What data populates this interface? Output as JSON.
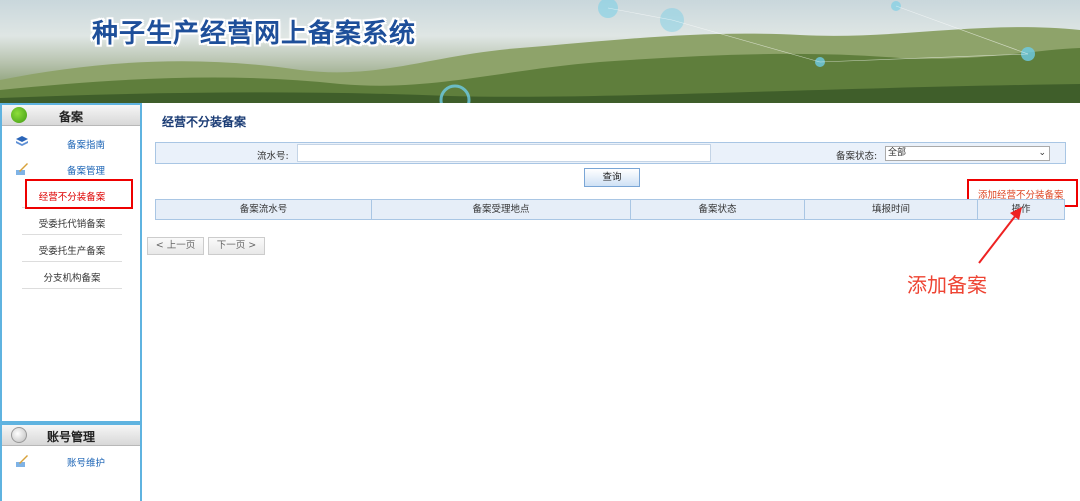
{
  "app": {
    "title": "种子生产经营网上备案系统"
  },
  "sidebar": {
    "section1_title": "备案",
    "guide": "备案指南",
    "manage": "备案管理",
    "items": [
      {
        "label": "经营不分装备案",
        "active": true
      },
      {
        "label": "受委托代销备案",
        "active": false
      },
      {
        "label": "受委托生产备案",
        "active": false
      },
      {
        "label": "分支机构备案",
        "active": false
      }
    ],
    "section2_title": "账号管理",
    "account_item": "账号维护"
  },
  "main": {
    "page_title": "经营不分装备案",
    "search": {
      "serial_label": "流水号:",
      "serial_value": "",
      "status_label": "备案状态:",
      "status_value": "全部",
      "button": "查询"
    },
    "add_link": "添加经营不分装备案",
    "columns": [
      "备案流水号",
      "备案受理地点",
      "备案状态",
      "填报时间",
      "操作"
    ],
    "rows": [],
    "pager": {
      "prev": "< 上一页",
      "next": "下一页 >"
    },
    "annotation": "添加备案"
  },
  "colors": {
    "accent": "#5fb3e0",
    "title_blue": "#1e4f9a",
    "highlight_red": "#e00000"
  }
}
